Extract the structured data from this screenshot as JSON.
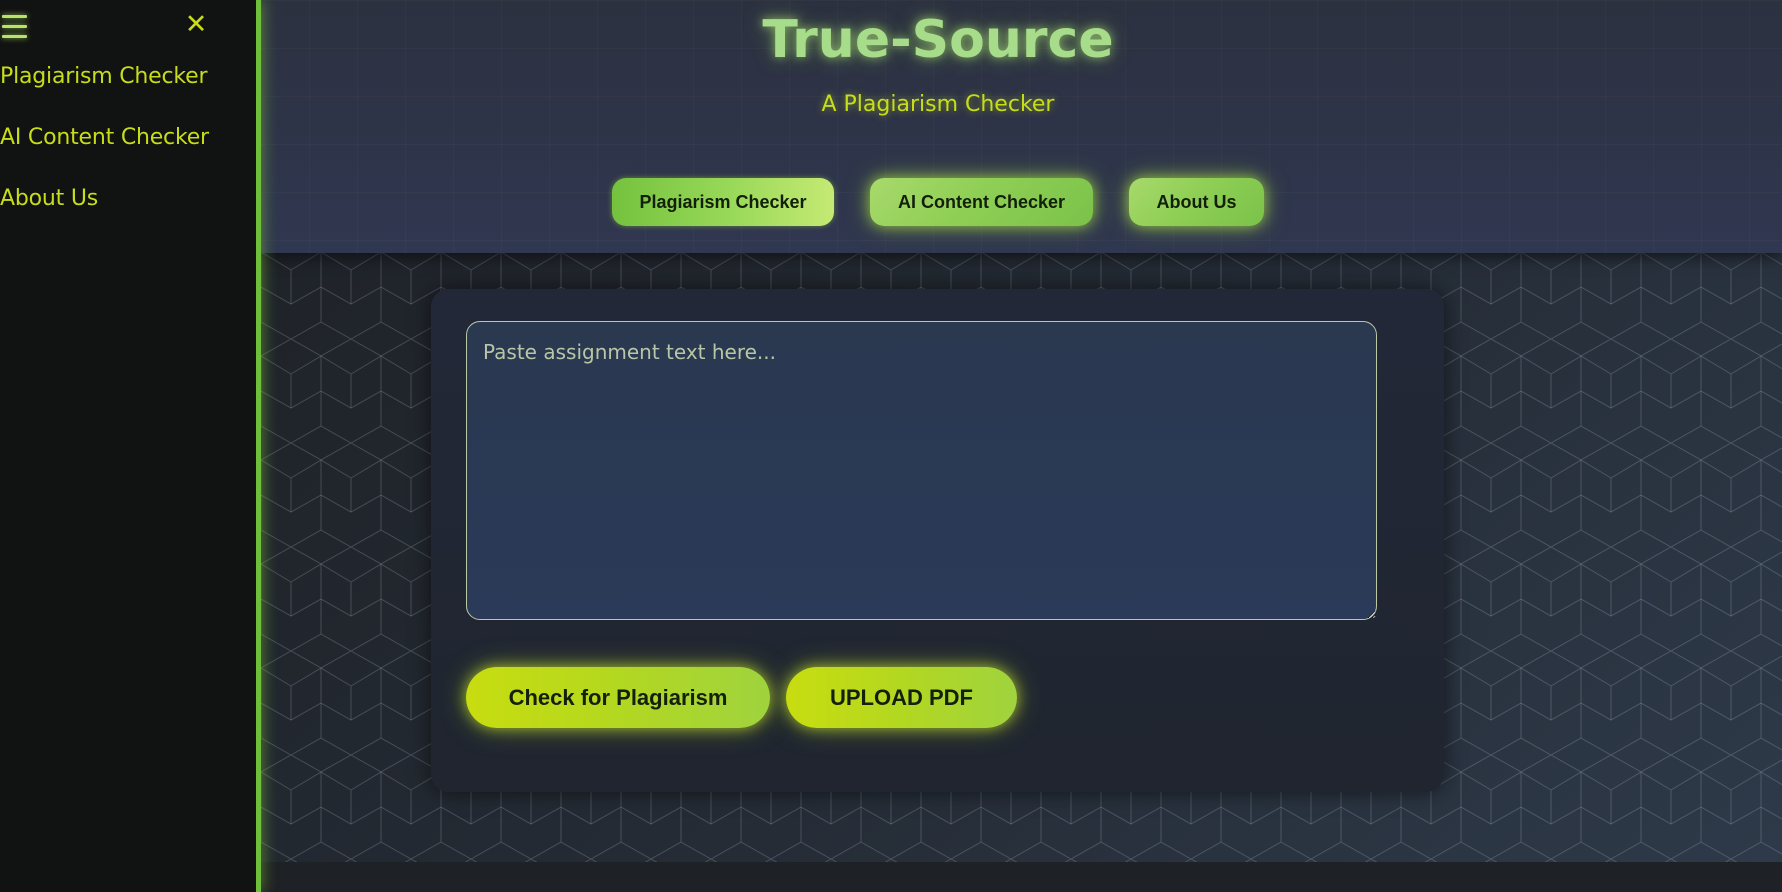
{
  "sidebar": {
    "menu_icon": "hamburger-menu-icon",
    "close_icon": "close-icon",
    "close_glyph": "✕",
    "links": [
      {
        "label": "Plagiarism Checker"
      },
      {
        "label": "AI Content Checker"
      },
      {
        "label": "About Us"
      }
    ]
  },
  "header": {
    "title": "True-Source",
    "subtitle": "A Plagiarism Checker",
    "nav": [
      {
        "label": "Plagiarism Checker",
        "active": true
      },
      {
        "label": "AI Content Checker",
        "active": false
      },
      {
        "label": "About Us",
        "active": false
      }
    ]
  },
  "form": {
    "textarea_placeholder": "Paste assignment text here...",
    "textarea_value": "",
    "check_button": "Check for Plagiarism",
    "upload_button": "UPLOAD PDF"
  },
  "colors": {
    "accent": "#c8dd1a",
    "title_green": "#a7dc8a",
    "sidebar_bg": "#111212",
    "header_bg": "#2e3448"
  }
}
